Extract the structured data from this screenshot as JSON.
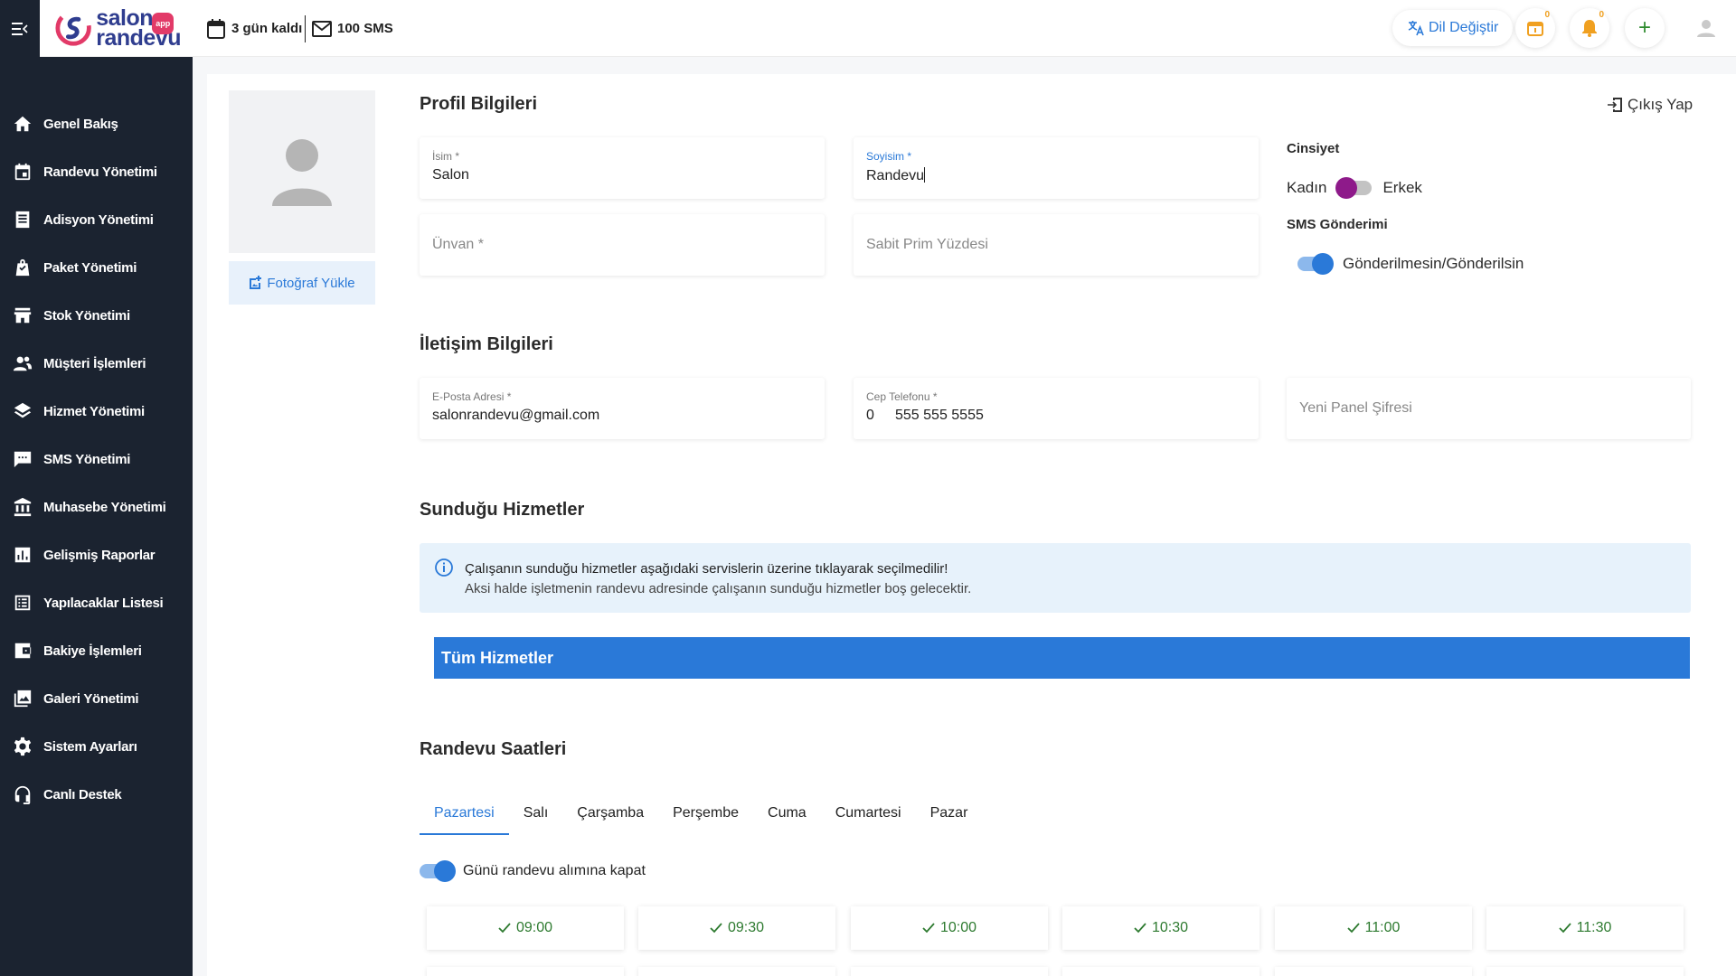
{
  "topbar": {
    "logo_line1": "salon",
    "logo_line2": "randevu",
    "logo_badge": "app",
    "trial": "3 gün kaldı",
    "sms": "100 SMS",
    "lang": "Dil Değiştir",
    "calendar_count": "0",
    "bell_count": "0",
    "add": "+"
  },
  "sidebar": {
    "items": [
      {
        "label": "Genel Bakış",
        "icon": "home-icon"
      },
      {
        "label": "Randevu Yönetimi",
        "icon": "calendar-icon"
      },
      {
        "label": "Adisyon Yönetimi",
        "icon": "receipt-icon"
      },
      {
        "label": "Paket Yönetimi",
        "icon": "bag-icon"
      },
      {
        "label": "Stok Yönetimi",
        "icon": "store-icon"
      },
      {
        "label": "Müşteri İşlemleri",
        "icon": "people-icon"
      },
      {
        "label": "Hizmet Yönetimi",
        "icon": "layers-icon"
      },
      {
        "label": "SMS Yönetimi",
        "icon": "chat-icon"
      },
      {
        "label": "Muhasebe Yönetimi",
        "icon": "bank-icon"
      },
      {
        "label": "Gelişmiş Raporlar",
        "icon": "chart-icon"
      },
      {
        "label": "Yapılacaklar Listesi",
        "icon": "list-icon"
      },
      {
        "label": "Bakiye İşlemleri",
        "icon": "wallet-icon"
      },
      {
        "label": "Galeri Yönetimi",
        "icon": "gallery-icon"
      },
      {
        "label": "Sistem Ayarları",
        "icon": "gear-icon"
      },
      {
        "label": "Canlı Destek",
        "icon": "headset-icon"
      }
    ]
  },
  "profile": {
    "upload": "Fotoğraf Yükle",
    "title": "Profil Bilgileri",
    "logout": "Çıkış Yap",
    "name_label": "İsim *",
    "name_value": "Salon",
    "surname_label": "Soyisim *",
    "surname_value": "Randevu",
    "title_placeholder": "Ünvan *",
    "bonus_placeholder": "Sabit Prim Yüzdesi",
    "gender_title": "Cinsiyet",
    "gender_female": "Kadın",
    "gender_male": "Erkek",
    "sms_title": "SMS Gönderimi",
    "sms_label": "Gönderilmesin/Gönderilsin"
  },
  "contact": {
    "title": "İletişim Bilgileri",
    "email_label": "E-Posta Adresi *",
    "email_value": "salonrandevu@gmail.com",
    "phone_label": "Cep Telefonu *",
    "phone_prefix": "0",
    "phone_value": "555 555 5555",
    "password_placeholder": "Yeni Panel Şifresi"
  },
  "services": {
    "title": "Sunduğu Hizmetler",
    "info_line1": "Çalışanın sunduğu hizmetler aşağıdaki servislerin üzerine tıklayarak seçilmedilir!",
    "info_line2": "Aksi halde işletmenin randevu adresinde çalışanın sunduğu hizmetler boş gelecektir.",
    "all_button": "Tüm Hizmetler"
  },
  "hours": {
    "title": "Randevu Saatleri",
    "tabs": [
      "Pazartesi",
      "Salı",
      "Çarşamba",
      "Perşembe",
      "Cuma",
      "Cumartesi",
      "Pazar"
    ],
    "close_label": "Günü randevu alımına kapat",
    "slots": [
      "09:00",
      "09:30",
      "10:00",
      "10:30",
      "11:00",
      "11:30"
    ]
  },
  "colors": {
    "sidebar_bg": "#1b2330",
    "accent": "#2a79d8",
    "gender_toggle": "#8e1a8a",
    "slot_text": "#2d7a2f"
  }
}
